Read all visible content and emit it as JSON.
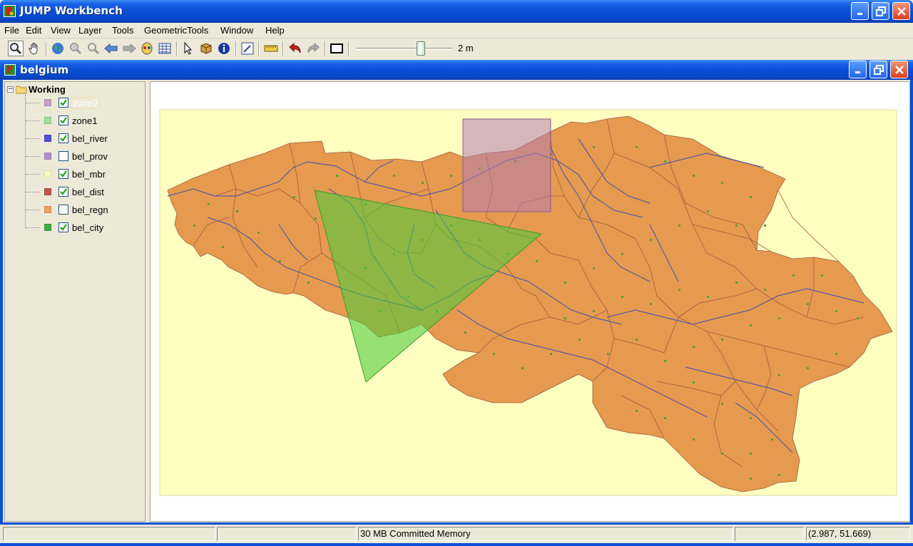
{
  "app": {
    "title": "JUMP Workbench"
  },
  "menu": [
    "File",
    "Edit",
    "View",
    "Layer",
    "Tools",
    "GeometricTools",
    "Window",
    "Help"
  ],
  "toolbar": {
    "buttons": [
      "zoom-tool",
      "pan-tool",
      "zoom-to-full-extent",
      "zoom-to-selection",
      "zoom-to-fence",
      "zoom-previous",
      "zoom-next",
      "zoom-to-layer",
      "zoom-bar",
      "select-features",
      "select-part",
      "feature-info",
      "edit-geometry",
      "measure",
      "undo",
      "redo",
      "draw-rectangle-fence"
    ],
    "scale_label": "2 m"
  },
  "frame": {
    "title": "belgium"
  },
  "layer_tree": {
    "category": "Working",
    "layers": [
      {
        "name": "zone2",
        "color": "#c8a0c8",
        "checked": true,
        "selected": true
      },
      {
        "name": "zone1",
        "color": "#a0e0a0",
        "checked": true,
        "selected": false
      },
      {
        "name": "bel_river",
        "color": "#5050d0",
        "checked": true,
        "selected": false
      },
      {
        "name": "bel_prov",
        "color": "#b090d0",
        "checked": false,
        "selected": false
      },
      {
        "name": "bel_mbr",
        "color": "#ffffc0",
        "checked": true,
        "selected": false
      },
      {
        "name": "bel_dist",
        "color": "#c85050",
        "checked": true,
        "selected": false
      },
      {
        "name": "bel_regn",
        "color": "#f0a060",
        "checked": false,
        "selected": false
      },
      {
        "name": "bel_city",
        "color": "#40b040",
        "checked": true,
        "selected": false
      }
    ]
  },
  "map": {
    "background": "#ffffff",
    "mbr_color": "#ffffc0",
    "region_color": "#e69a50",
    "region_stroke": "#9a5a3a",
    "river_color": "#5a5a9a",
    "city_color": "#5a9a3a",
    "zone1_color": "#4ccc3c",
    "zone2_color": "#b07cb0"
  },
  "status": {
    "cell1": "",
    "cell2": "",
    "memory": "30 MB Committed Memory",
    "cell4": "",
    "coords": "(2.987, 51.669)"
  }
}
